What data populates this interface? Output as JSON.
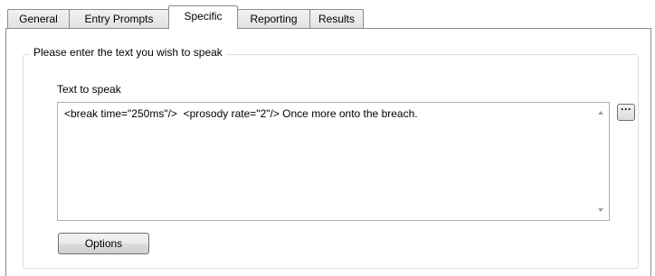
{
  "tabs": [
    {
      "label": "General",
      "active": false
    },
    {
      "label": "Entry Prompts",
      "active": false
    },
    {
      "label": "Specific",
      "active": true
    },
    {
      "label": "Reporting",
      "active": false
    },
    {
      "label": "Results",
      "active": false
    }
  ],
  "group": {
    "title": "Please enter the text you wish to speak",
    "field_label": "Text to speak",
    "text_value": "<break time=\"250ms\"/>  <prosody rate=\"2\"/> Once more onto the breach.",
    "browse_label": "···",
    "options_label": "Options"
  }
}
